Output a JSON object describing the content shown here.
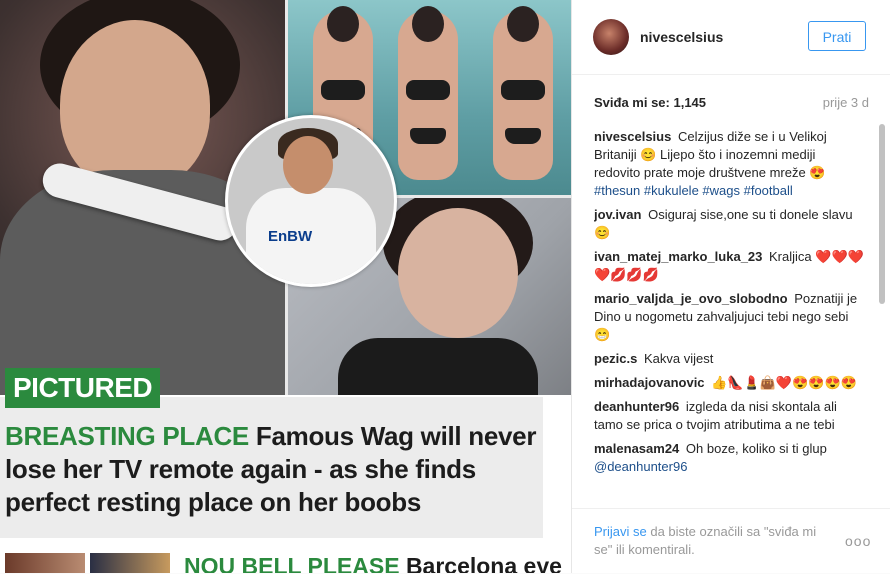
{
  "article": {
    "badge": "PICTURED",
    "headline_kicker": "BREASTING PLACE",
    "headline_text": "Famous Wag will never lose her TV remote again - as she finds perfect resting place on her boobs",
    "sponsor_text": "EnBW",
    "next_kicker": "NOU BELL PLEASE",
    "next_text": "Barcelona eye"
  },
  "post": {
    "username": "nivescelsius",
    "follow_label": "Prati",
    "likes": "Sviđa mi se: 1,145",
    "time": "prije 3 d"
  },
  "comments": [
    {
      "user": "nivescelsius",
      "text": "Celzijus diže se i u Velikoj Britaniji 😊 Lijepo što i inozemni mediji redovito prate moje društvene mreže 😍",
      "tags": "#thesun #kukulele #wags #football"
    },
    {
      "user": "jov.ivan",
      "text": "Osiguraj sise,one su ti donele slavu😊",
      "tags": ""
    },
    {
      "user": "ivan_matej_marko_luka_23",
      "text": "Kraljica ❤️❤️❤️❤️💋💋💋",
      "tags": ""
    },
    {
      "user": "mario_valjda_je_ovo_slobodno",
      "text": "Poznatiji je Dino u nogometu zahvaljujuci tebi nego sebi 😁",
      "tags": ""
    },
    {
      "user": "pezic.s",
      "text": "Kakva vijest",
      "tags": ""
    },
    {
      "user": "mirhadajovanovic",
      "text": "👍👠💄👜❤️😍😍😍😍",
      "tags": ""
    },
    {
      "user": "deanhunter96",
      "text": "izgleda da nisi skontala ali tamo se prica o tvojim atributima a ne tebi",
      "tags": ""
    },
    {
      "user": "malenasam24",
      "text": "Oh boze, koliko si ti glup",
      "tags": "@deanhunter96"
    }
  ],
  "footer": {
    "login_link": "Prijavi se",
    "login_text": " da biste označili sa \"sviđa mi se\" ili komentirali.",
    "more": "ooo"
  },
  "icons": {
    "more": "more-options-icon"
  }
}
